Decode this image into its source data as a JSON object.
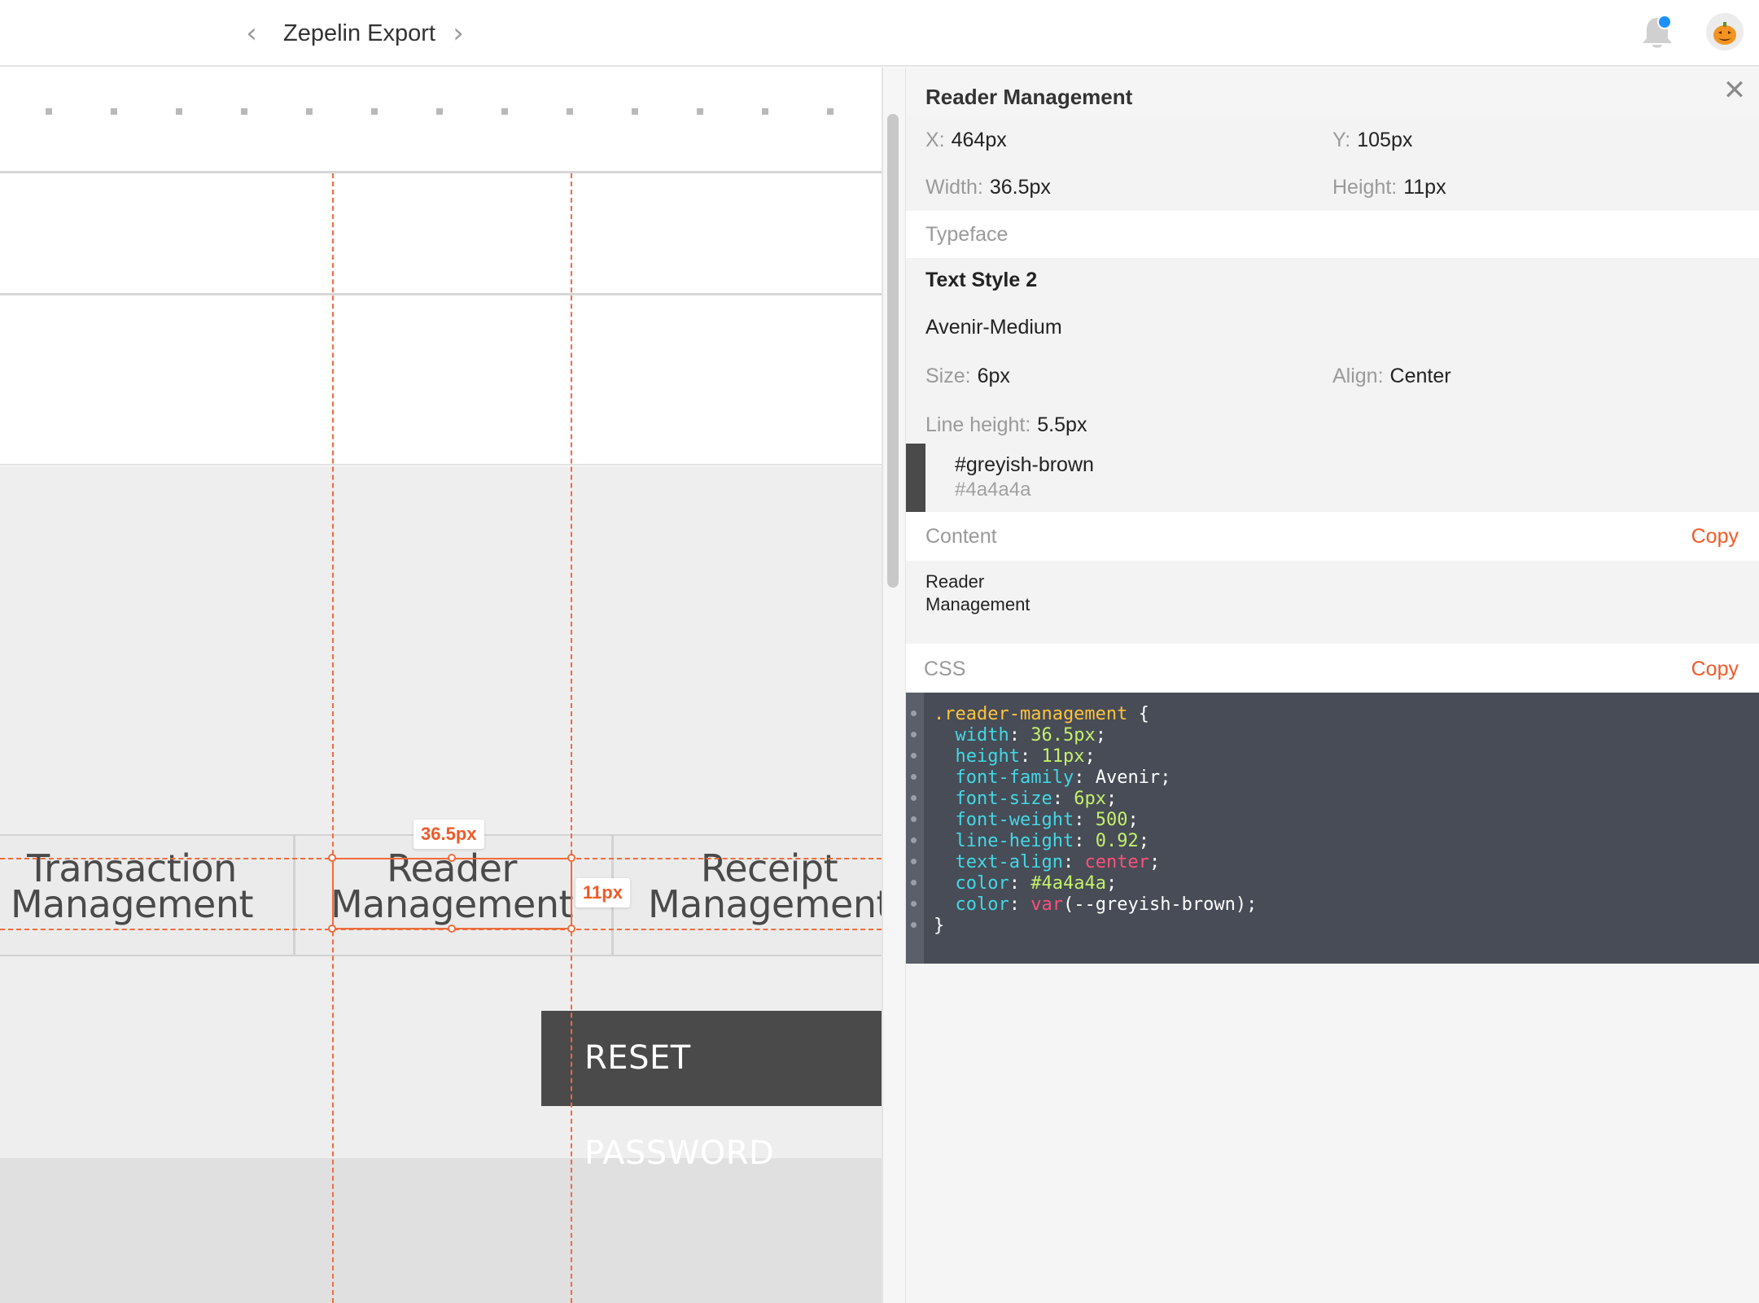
{
  "topbar": {
    "project_title": "Zepelin Export",
    "prev_icon": "‹",
    "next_icon": "›",
    "notification_dot_color": "#1a91ff"
  },
  "canvas": {
    "tabs": [
      {
        "label": "Transaction\nManagement"
      },
      {
        "label": "Reader\nManagement"
      },
      {
        "label": "Receipt\nManagement"
      }
    ],
    "reset_button": "RESET PASSWORD",
    "width_measure": "36.5px",
    "height_measure": "11px",
    "accent_color": "#f26b3a"
  },
  "inspector": {
    "title": "Reader Management",
    "close_icon": "✕",
    "x_label": "X:",
    "x_value": "464px",
    "y_label": "Y:",
    "y_value": "105px",
    "width_label": "Width:",
    "width_value": "36.5px",
    "height_label": "Height:",
    "height_value": "11px",
    "typeface_header": "Typeface",
    "text_style": "Text Style 2",
    "font_name": "Avenir-Medium",
    "size_label": "Size:",
    "size_value": "6px",
    "align_label": "Align:",
    "align_value": "Center",
    "line_height_label": "Line height:",
    "line_height_value": "5.5px",
    "color_name": "#greyish-brown",
    "color_hex": "#4a4a4a",
    "content_header": "Content",
    "content_copy": "Copy",
    "content_text": "Reader\nManagement",
    "css_header": "CSS",
    "css_copy": "Copy",
    "css_code": {
      "selector": ".reader-management",
      "open_brace": " {",
      "props": [
        {
          "prop": "width",
          "value": "36.5px",
          "kind": "num"
        },
        {
          "prop": "height",
          "value": "11px",
          "kind": "num"
        },
        {
          "prop": "font-family",
          "value": "Avenir",
          "kind": "plain"
        },
        {
          "prop": "font-size",
          "value": "6px",
          "kind": "num"
        },
        {
          "prop": "font-weight",
          "value": "500",
          "kind": "num"
        },
        {
          "prop": "line-height",
          "value": "0.92",
          "kind": "num"
        },
        {
          "prop": "text-align",
          "value": "center",
          "kind": "kw"
        },
        {
          "prop": "color",
          "value": "#4a4a4a",
          "kind": "num"
        },
        {
          "prop": "color",
          "value_fn": "var",
          "value_arg": "(--greyish-brown)",
          "kind": "fn"
        }
      ],
      "close_brace": "}"
    }
  }
}
